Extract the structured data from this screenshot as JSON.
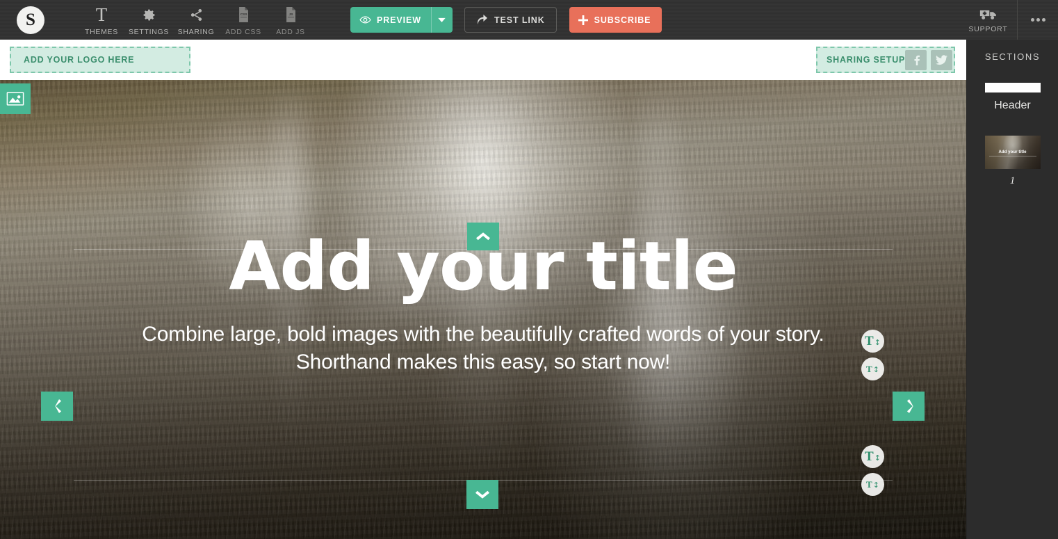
{
  "toolbar": {
    "brand_initial": "S",
    "brand_name": "shorthand-logo",
    "items": [
      {
        "label": "THEMES",
        "icon": "text-T-icon",
        "dim": false
      },
      {
        "label": "SETTINGS",
        "icon": "gear-icon",
        "dim": false
      },
      {
        "label": "SHARING",
        "icon": "share-icon",
        "dim": false
      },
      {
        "label": "ADD CSS",
        "icon": "css-document-icon",
        "dim": true
      },
      {
        "label": "ADD JS",
        "icon": "js-document-icon",
        "dim": true
      }
    ],
    "preview_label": "PREVIEW",
    "preview_icon": "eye-icon",
    "preview_caret_icon": "caret-down-icon",
    "test_link_label": "TEST LINK",
    "test_link_icon": "arrow-curve-icon",
    "subscribe_label": "SUBSCRIBE",
    "subscribe_icon": "plus-icon",
    "support_label": "SUPPORT",
    "support_icon": "ambulance-icon",
    "more_label": "more-options",
    "colors": {
      "bar": "#313131",
      "preview_green": "#48b793",
      "subscribe_orange": "#e8705a"
    }
  },
  "sections": {
    "title": "SECTIONS",
    "items": [
      {
        "label": "Header",
        "type": "header-thumb"
      },
      {
        "label": "1",
        "type": "image-thumb",
        "thumb_title": "Add your title"
      }
    ]
  },
  "canvas": {
    "logo_placeholder": "ADD YOUR LOGO HERE",
    "sharing_placeholder": "SHARING SETUP",
    "social": [
      {
        "name": "facebook-icon",
        "glyph": "f"
      },
      {
        "name": "twitter-icon",
        "glyph": "t"
      }
    ],
    "hero": {
      "title": "Add your title",
      "subtitle": "Combine large, bold images with the beautifully crafted words of your story. Shorthand makes this easy, so start now!",
      "image_tool_icon": "picture-icon",
      "nav": {
        "up": "chevron-up-icon",
        "down": "chevron-down-icon",
        "prev": "chevron-left-icon",
        "next": "chevron-right-icon"
      },
      "text_tools": [
        {
          "name": "title-size-increase",
          "size": "big",
          "arrow": "↕"
        },
        {
          "name": "title-size-decrease",
          "size": "small",
          "arrow": "↕"
        },
        {
          "name": "subtitle-size-increase",
          "size": "big",
          "arrow": "↕"
        },
        {
          "name": "subtitle-size-decrease",
          "size": "small",
          "arrow": "↕"
        }
      ]
    }
  }
}
